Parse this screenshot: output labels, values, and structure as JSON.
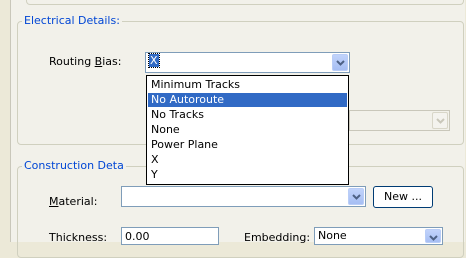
{
  "electrical": {
    "legend": "Electrical Details:",
    "routing_bias_label_pre": "Routing ",
    "routing_bias_label_u": "B",
    "routing_bias_label_post": "ias:",
    "routing_bias_value": "X",
    "options": [
      "Minimum Tracks",
      "No Autoroute",
      "No Tracks",
      "None",
      "Power Plane",
      "X",
      "Y"
    ],
    "highlighted_option": "No Autoroute"
  },
  "construction": {
    "legend": "Construction Deta",
    "material_label_u": "M",
    "material_label_post": "aterial:",
    "material_value": "",
    "new_button": "New ...",
    "thickness_label": "Thickness:",
    "thickness_value": "0.00",
    "embedding_label": "Embedding:",
    "embedding_value": "None"
  },
  "colors": {
    "legend_text": "#0046d5",
    "highlight": "#316ac5",
    "window_bg": "#ece9d8"
  }
}
